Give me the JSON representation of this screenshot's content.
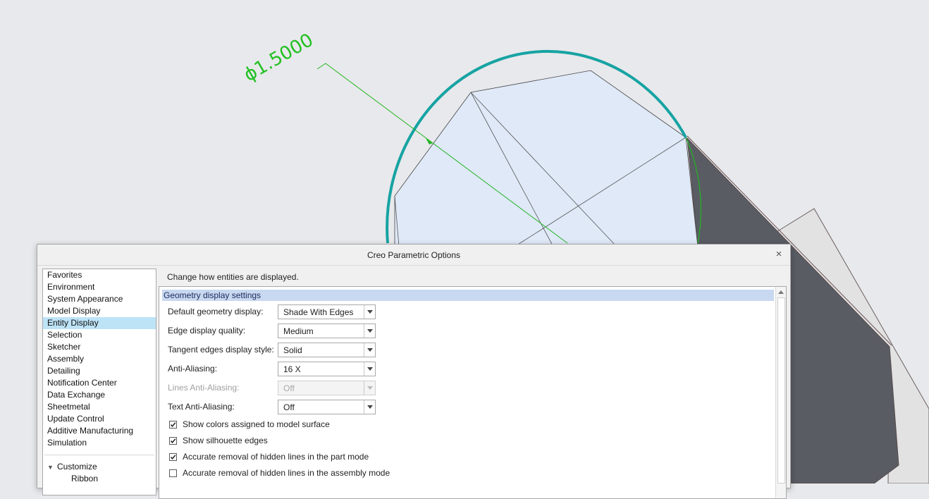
{
  "viewport": {
    "dimension_label": "ϕ1.5000",
    "colors": {
      "background": "#e8e9ec",
      "edge_highlight": "#17a3a3",
      "dimension": "#22c022",
      "face_fill": "#dfe9f8",
      "dark_face": "#595c63"
    }
  },
  "dialog": {
    "title": "Creo Parametric Options",
    "close_icon": "×",
    "nav": {
      "items": [
        {
          "label": "Favorites",
          "selected": false
        },
        {
          "label": "Environment",
          "selected": false
        },
        {
          "label": "System Appearance",
          "selected": false
        },
        {
          "label": "Model Display",
          "selected": false
        },
        {
          "label": "Entity Display",
          "selected": true
        },
        {
          "label": "Selection",
          "selected": false
        },
        {
          "label": "Sketcher",
          "selected": false
        },
        {
          "label": "Assembly",
          "selected": false
        },
        {
          "label": "Detailing",
          "selected": false
        },
        {
          "label": "Notification Center",
          "selected": false
        },
        {
          "label": "Data Exchange",
          "selected": false
        },
        {
          "label": "Sheetmetal",
          "selected": false
        },
        {
          "label": "Update Control",
          "selected": false
        },
        {
          "label": "Additive Manufacturing",
          "selected": false
        },
        {
          "label": "Simulation",
          "selected": false
        }
      ],
      "customize": {
        "toggle_icon": "▼",
        "label": "Customize",
        "children": [
          "Ribbon"
        ]
      },
      "selected_color": "#bde3f7"
    },
    "content": {
      "description": "Change how entities are displayed.",
      "section_title": "Geometry display settings",
      "settings": [
        {
          "label": "Default geometry display:",
          "value": "Shade With Edges",
          "enabled": true
        },
        {
          "label": "Edge display quality:",
          "value": "Medium",
          "enabled": true
        },
        {
          "label": "Tangent edges display style:",
          "value": "Solid",
          "enabled": true
        },
        {
          "label": "Anti-Aliasing:",
          "value": "16 X",
          "enabled": true
        },
        {
          "label": "Lines Anti-Aliasing:",
          "value": "Off",
          "enabled": false
        },
        {
          "label": "Text Anti-Aliasing:",
          "value": "Off",
          "enabled": true
        }
      ],
      "checkboxes": [
        {
          "label": "Show colors assigned to model surface",
          "checked": true
        },
        {
          "label": "Show silhouette edges",
          "checked": true
        },
        {
          "label": "Accurate removal of hidden lines in the part mode",
          "checked": true
        },
        {
          "label": "Accurate removal of hidden lines in the assembly mode",
          "checked": false
        }
      ]
    }
  }
}
